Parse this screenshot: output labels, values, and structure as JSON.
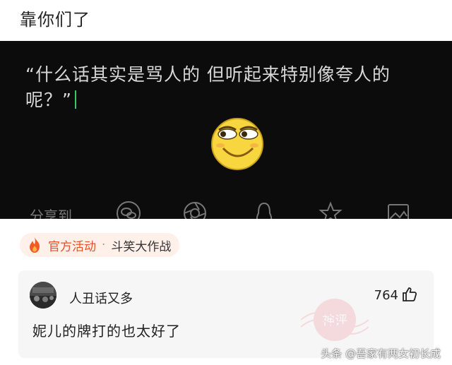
{
  "header": {
    "title": "靠你们了"
  },
  "post_image": {
    "quote": "“什么话其实是骂人的  但听起来特别像夸人的呢？”",
    "share_label": "分享到"
  },
  "activity": {
    "label": "官方活动",
    "separator": "·",
    "topic": "斗笑大作战"
  },
  "comment": {
    "username": "人丑话又多",
    "likes": "764",
    "text": "妮儿的牌打的也太好了",
    "stamp_text": "神评"
  },
  "watermark": "头条 @吾家有两女初长成",
  "colors": {
    "accent": "#e8512b",
    "activity_bg": "#fff1ea",
    "comment_bg": "#f6f6f6",
    "caret": "#3ec46d"
  }
}
